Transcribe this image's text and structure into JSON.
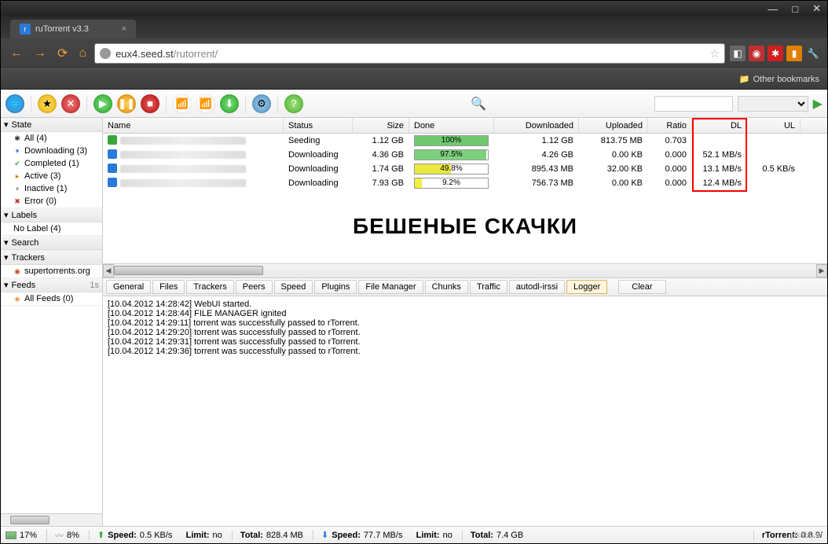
{
  "window": {
    "minimize": "—",
    "maximize": "□",
    "close": "✕"
  },
  "browser": {
    "tab_title": "ruTorrent v3.3",
    "url_host": "eux4.seed.st",
    "url_path": "/rutorrent/",
    "bookmarks_label": "Other bookmarks"
  },
  "toolbar": {
    "search_placeholder": ""
  },
  "sidebar": {
    "state_label": "State",
    "labels_label": "Labels",
    "search_label": "Search",
    "trackers_label": "Trackers",
    "feeds_label": "Feeds",
    "feeds_time": "1s",
    "state": [
      {
        "icon": "✱",
        "color": "#333",
        "label": "All (4)"
      },
      {
        "icon": "▾",
        "color": "#2a7ad9",
        "label": "Downloading (3)"
      },
      {
        "icon": "✔",
        "color": "#3aa53a",
        "label": "Completed (1)"
      },
      {
        "icon": "▸",
        "color": "#e07000",
        "label": "Active (3)"
      },
      {
        "icon": "⏸",
        "color": "#888",
        "label": "Inactive (1)"
      },
      {
        "icon": "✖",
        "color": "#c03030",
        "label": "Error (0)"
      }
    ],
    "nolabel": "No Label (4)",
    "tracker_item": "supertorrents.org",
    "feeds_item": "All Feeds (0)"
  },
  "grid": {
    "columns": {
      "name": "Name",
      "status": "Status",
      "size": "Size",
      "done": "Done",
      "downloaded": "Downloaded",
      "uploaded": "Uploaded",
      "ratio": "Ratio",
      "dl": "DL",
      "ul": "UL"
    },
    "rows": [
      {
        "icon_color": "#3aa53a",
        "status": "Seeding",
        "size": "1.12 GB",
        "done_pct": 100,
        "done_color": "#6ec96e",
        "done_text": "100%",
        "downloaded": "1.12 GB",
        "uploaded": "813.75 MB",
        "ratio": "0.703",
        "dl": "",
        "ul": ""
      },
      {
        "icon_color": "#2a7ad9",
        "status": "Downloading",
        "size": "4.36 GB",
        "done_pct": 97.5,
        "done_color": "#7dd07d",
        "done_text": "97.5%",
        "downloaded": "4.26 GB",
        "uploaded": "0.00 KB",
        "ratio": "0.000",
        "dl": "52.1 MB/s",
        "ul": ""
      },
      {
        "icon_color": "#2a7ad9",
        "status": "Downloading",
        "size": "1.74 GB",
        "done_pct": 49.8,
        "done_color": "#e8e840",
        "done_text": "49.8%",
        "downloaded": "895.43 MB",
        "uploaded": "32.00 KB",
        "ratio": "0.000",
        "dl": "13.1 MB/s",
        "ul": "0.5 KB/s"
      },
      {
        "icon_color": "#2a7ad9",
        "status": "Downloading",
        "size": "7.93 GB",
        "done_pct": 9.2,
        "done_color": "#f0f040",
        "done_text": "9.2%",
        "downloaded": "756.73 MB",
        "uploaded": "0.00 KB",
        "ratio": "0.000",
        "dl": "12.4 MB/s",
        "ul": ""
      }
    ]
  },
  "overlay_text": "БЕШЕНЫЕ СКАЧКИ",
  "bottom_tabs": [
    "General",
    "Files",
    "Trackers",
    "Peers",
    "Speed",
    "Plugins",
    "File Manager",
    "Chunks",
    "Traffic",
    "autodl-irssi",
    "Logger"
  ],
  "active_tab": "Logger",
  "clear_label": "Clear",
  "log": [
    "[10.04.2012 14:28:42] WebUI started.",
    "[10.04.2012 14:28:44] FILE MANAGER ignited",
    "[10.04.2012 14:29:11] torrent was successfully passed to rTorrent.",
    "[10.04.2012 14:29:20] torrent was successfully passed to rTorrent.",
    "[10.04.2012 14:29:31] torrent was successfully passed to rTorrent.",
    "[10.04.2012 14:29:36] torrent was successfully passed to rTorrent."
  ],
  "status": {
    "disk_pct": "17%",
    "cpu_pct": "8%",
    "up_speed_label": "Speed:",
    "up_speed": "0.5 KB/s",
    "limit_label": "Limit:",
    "limit_val": "no",
    "up_total_label": "Total:",
    "up_total": "828.4 MB",
    "dn_speed": "77.7 MB/s",
    "dn_total": "7.4 GB",
    "rtorrent_label": "rTorrent:",
    "rtorrent_ver": "0.8.9/"
  },
  "watermark": "pikabu.ru"
}
